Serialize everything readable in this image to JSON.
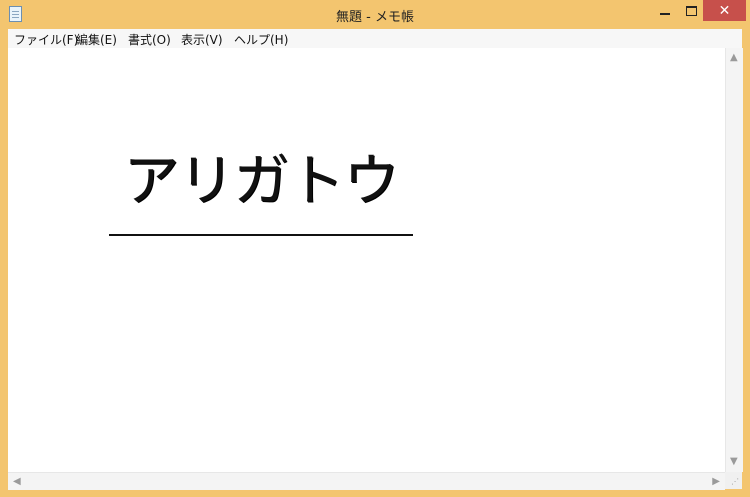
{
  "window": {
    "title": "無題 - メモ帳",
    "icons": {
      "app": "notepad-icon",
      "minimize": "minimize-icon",
      "maximize": "maximize-icon",
      "close": "close-icon",
      "close_glyph": "✕"
    }
  },
  "menu": {
    "items": [
      {
        "label": "ファイル(F)"
      },
      {
        "label": "編集(E)"
      },
      {
        "label": "書式(O)"
      },
      {
        "label": "表示(V)"
      },
      {
        "label": "ヘルプ(H)"
      }
    ]
  },
  "document": {
    "text": "アリガトウ"
  },
  "scrollbars": {
    "up_glyph": "▲",
    "down_glyph": "▼",
    "left_glyph": "◀",
    "right_glyph": "▶",
    "grip_glyph": "⋰"
  },
  "colors": {
    "window_frame": "#f3c56f",
    "close_button": "#c7504b",
    "editor_background": "#ffffff"
  }
}
